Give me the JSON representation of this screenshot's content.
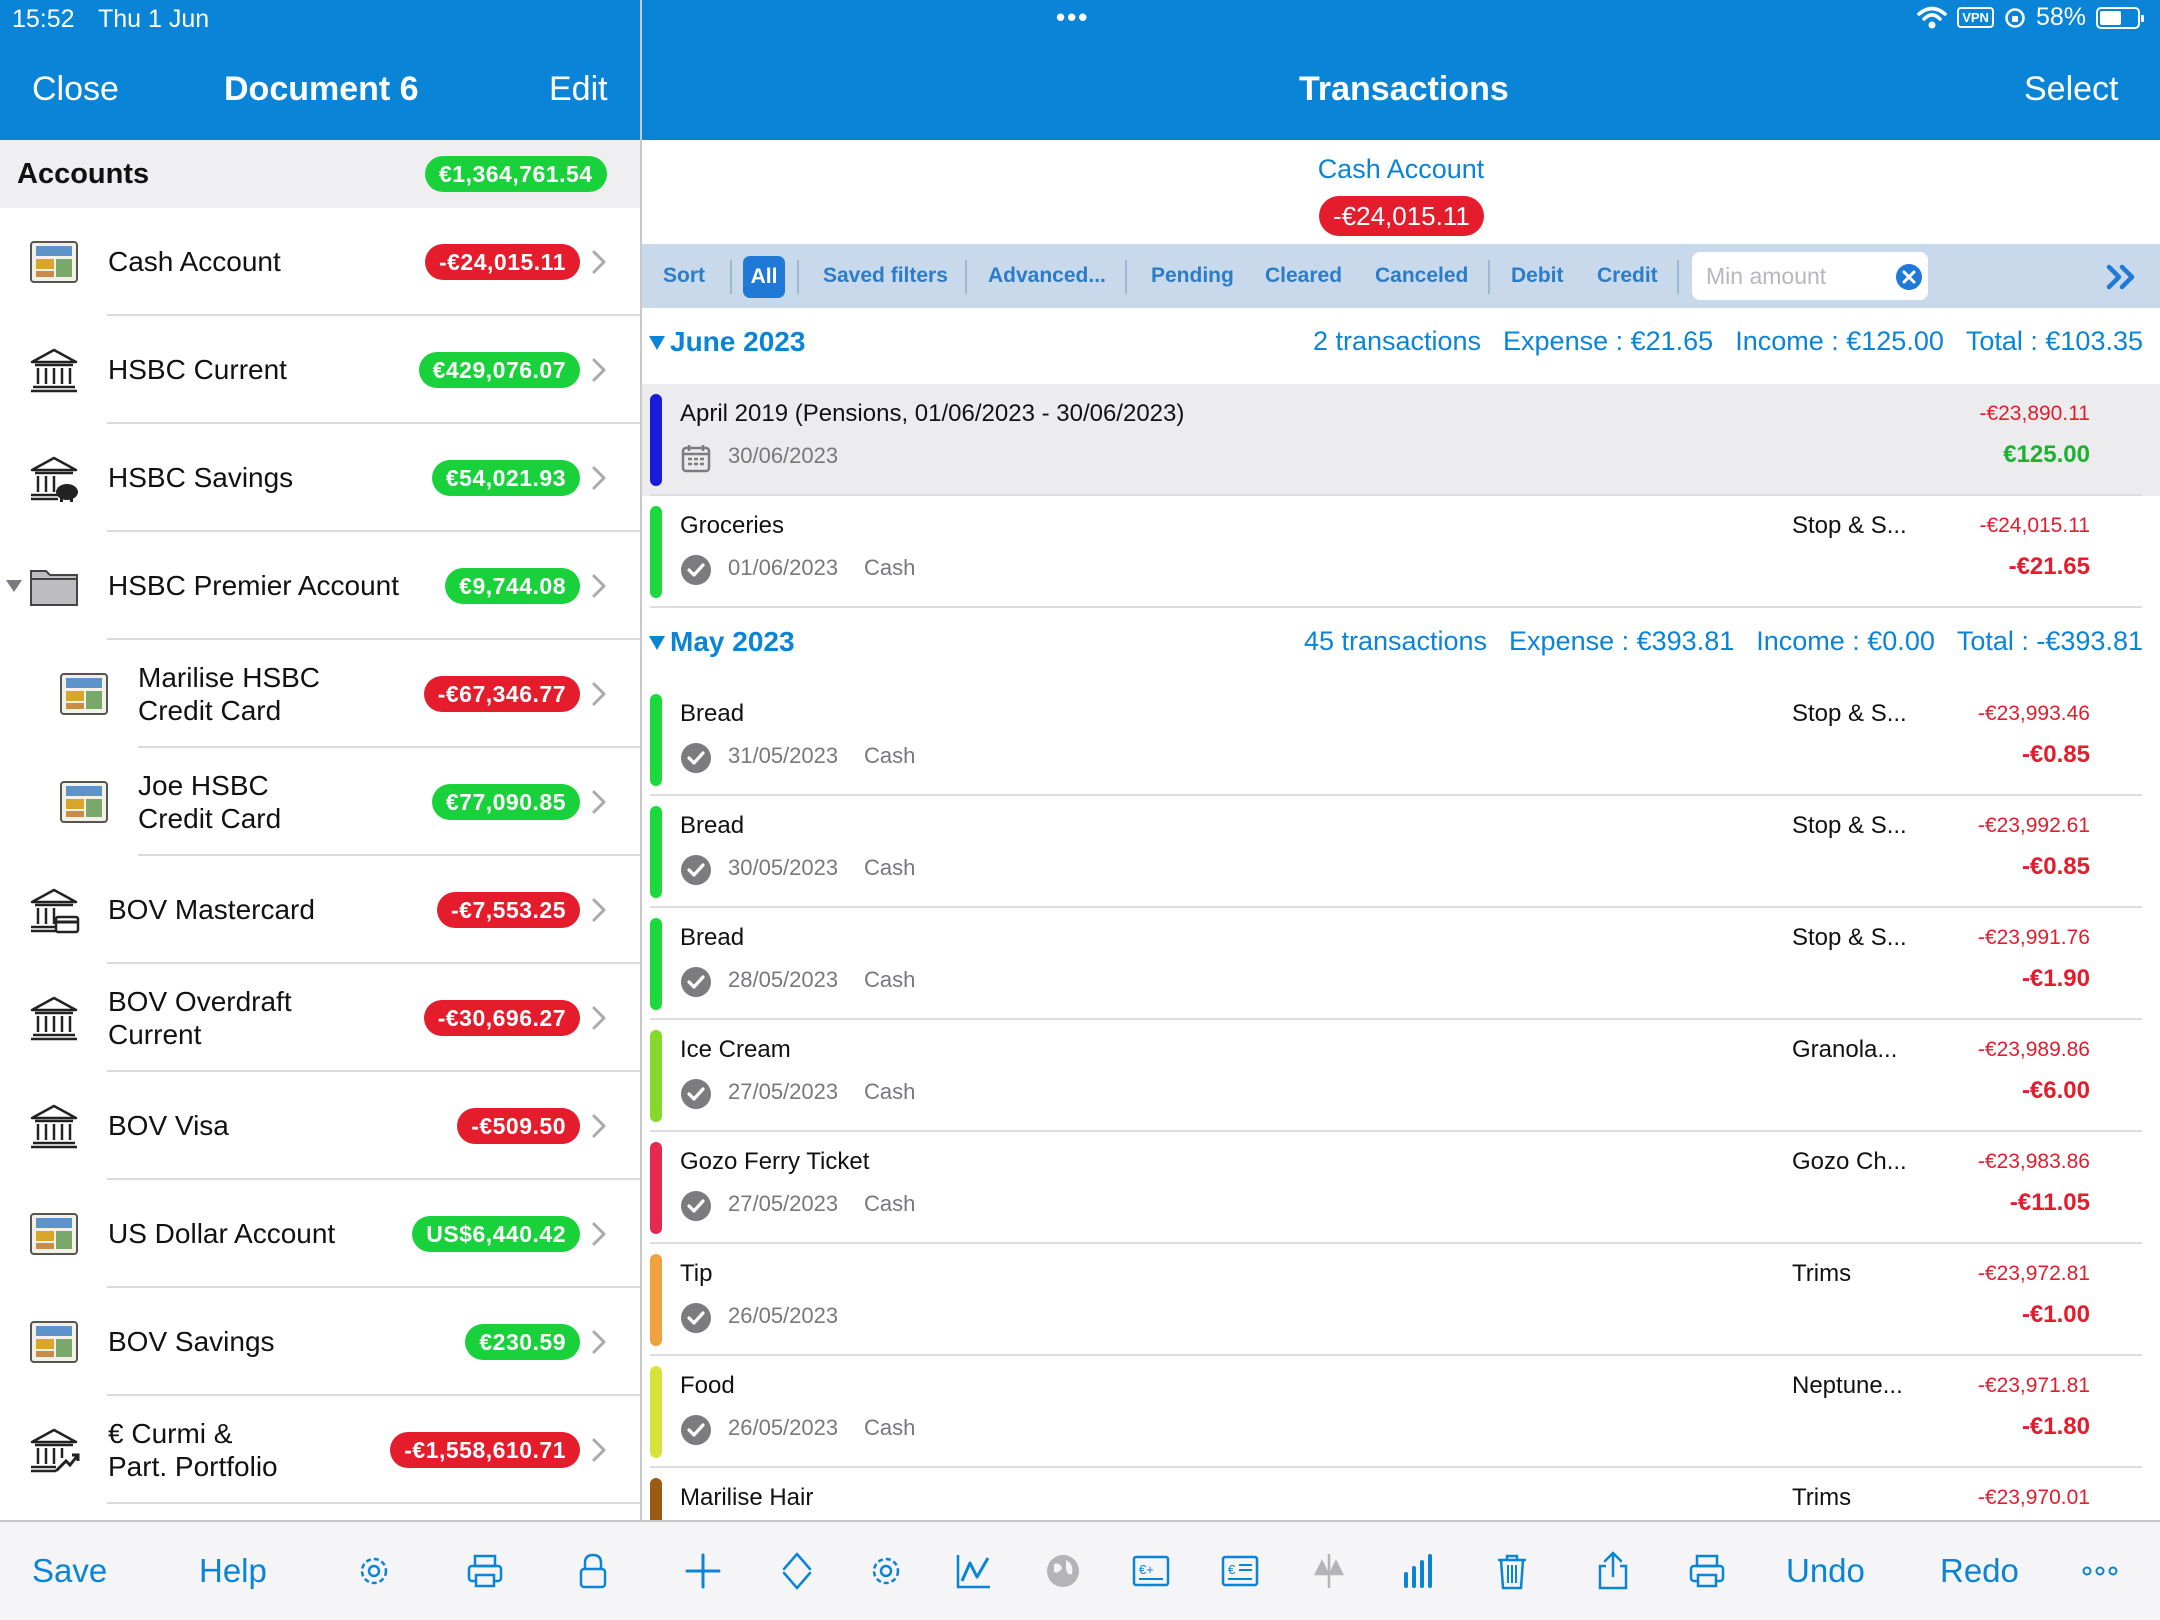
{
  "status": {
    "time": "15:52",
    "date": "Thu 1 Jun",
    "vpn": "VPN",
    "battery": "58%",
    "battery_level": 0.58,
    "dots": "•••"
  },
  "left_nav": {
    "close": "Close",
    "title": "Document 6",
    "edit": "Edit"
  },
  "right_nav": {
    "title": "Transactions",
    "select": "Select"
  },
  "accounts": {
    "title": "Accounts",
    "total": "€1,364,761.54",
    "items": [
      {
        "name": "Cash Account",
        "balance": "-€24,015.11",
        "icon": "card-icon"
      },
      {
        "name": "HSBC Current",
        "balance": "€429,076.07",
        "icon": "bank-icon"
      },
      {
        "name": "HSBC Savings",
        "balance": "€54,021.93",
        "icon": "bank-piggy-icon"
      },
      {
        "name": "HSBC Premier Account",
        "balance": "€9,744.08",
        "icon": "folder-icon"
      },
      {
        "name": "Marilise HSBC\nCredit Card",
        "balance": "-€67,346.77",
        "icon": "card-icon"
      },
      {
        "name": "Joe HSBC\nCredit Card",
        "balance": "€77,090.85",
        "icon": "card-icon"
      },
      {
        "name": "BOV Mastercard",
        "balance": "-€7,553.25",
        "icon": "bank-card-icon"
      },
      {
        "name": "BOV Overdraft\nCurrent",
        "balance": "-€30,696.27",
        "icon": "bank-icon"
      },
      {
        "name": "BOV Visa",
        "balance": "-€509.50",
        "icon": "bank-icon"
      },
      {
        "name": "US Dollar Account",
        "balance": "US$6,440.42",
        "icon": "card-icon"
      },
      {
        "name": "BOV Savings",
        "balance": "€230.59",
        "icon": "card-icon"
      },
      {
        "name": "€ Curmi &\nPart. Portfolio",
        "balance": "-€1,558,610.71",
        "icon": "bank-trend-icon"
      }
    ]
  },
  "account_header": {
    "name": "Cash Account",
    "balance": "-€24,015.11"
  },
  "filters": {
    "sort": "Sort",
    "all": "All",
    "saved": "Saved filters",
    "advanced": "Advanced...",
    "pending": "Pending",
    "cleared": "Cleared",
    "canceled": "Canceled",
    "debit": "Debit",
    "credit": "Credit",
    "min_placeholder": "Min amount"
  },
  "groups": [
    {
      "title": "June 2023",
      "count": "2 transactions",
      "expense": "Expense : €21.65",
      "income": "Income : €125.00",
      "total": "Total : €103.35",
      "transactions": [
        {
          "name": "April 2019 (Pensions, 01/06/2023 - 30/06/2023)",
          "date": "30/06/2023",
          "method": "",
          "payee": "",
          "balance": "-€23,890.11",
          "amount": "€125.00",
          "color": "#1a1adb",
          "icon": "calendar-icon",
          "positive": true,
          "highlight": true
        },
        {
          "name": "Groceries",
          "date": "01/06/2023",
          "method": "Cash",
          "payee": "Stop & S...",
          "balance": "-€24,015.11",
          "amount": "-€21.65",
          "color": "#1ed93c",
          "icon": "check-icon"
        }
      ]
    },
    {
      "title": "May 2023",
      "count": "45 transactions",
      "expense": "Expense : €393.81",
      "income": "Income : €0.00",
      "total": "Total : -€393.81",
      "transactions": [
        {
          "name": "Bread",
          "date": "31/05/2023",
          "method": "Cash",
          "payee": "Stop & S...",
          "balance": "-€23,993.46",
          "amount": "-€0.85",
          "color": "#1ed93c",
          "icon": "check-icon"
        },
        {
          "name": "Bread",
          "date": "30/05/2023",
          "method": "Cash",
          "payee": "Stop & S...",
          "balance": "-€23,992.61",
          "amount": "-€0.85",
          "color": "#1ed93c",
          "icon": "check-icon"
        },
        {
          "name": "Bread",
          "date": "28/05/2023",
          "method": "Cash",
          "payee": "Stop & S...",
          "balance": "-€23,991.76",
          "amount": "-€1.90",
          "color": "#1ed93c",
          "icon": "check-icon"
        },
        {
          "name": "Ice Cream",
          "date": "27/05/2023",
          "method": "Cash",
          "payee": "Granola...",
          "balance": "-€23,989.86",
          "amount": "-€6.00",
          "color": "#86d82a",
          "icon": "check-icon"
        },
        {
          "name": "Gozo Ferry Ticket",
          "date": "27/05/2023",
          "method": "Cash",
          "payee": "Gozo Ch...",
          "balance": "-€23,983.86",
          "amount": "-€11.05",
          "color": "#e6294f",
          "icon": "check-icon"
        },
        {
          "name": "Tip",
          "date": "26/05/2023",
          "method": "",
          "payee": "Trims",
          "balance": "-€23,972.81",
          "amount": "-€1.00",
          "color": "#f0a23e",
          "icon": "check-icon"
        },
        {
          "name": "Food",
          "date": "26/05/2023",
          "method": "Cash",
          "payee": "Neptune...",
          "balance": "-€23,971.81",
          "amount": "-€1.80",
          "color": "#d6e33a",
          "icon": "check-icon"
        },
        {
          "name": "Marilise Hair",
          "date": "",
          "method": "",
          "payee": "Trims",
          "balance": "-€23,970.01",
          "amount": "",
          "color": "#9a5b12",
          "icon": "check-icon"
        }
      ]
    }
  ],
  "bottom_left": {
    "save": "Save",
    "help": "Help"
  },
  "bottom_right": {
    "undo": "Undo",
    "redo": "Redo"
  }
}
